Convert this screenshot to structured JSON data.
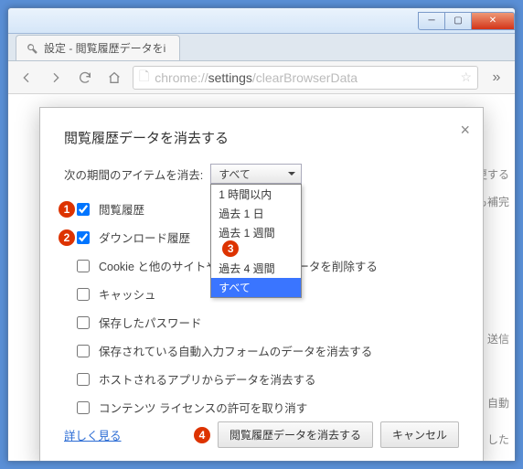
{
  "window": {
    "tab_title": "設定 - 閲覧履歴データをi"
  },
  "omnibox": {
    "prefix": "chrome://",
    "host": "settings",
    "path": "/clearBrowserData"
  },
  "background_hints": [
    "更する",
    "も補完",
    "送信",
    "自動",
    "した"
  ],
  "modal": {
    "title": "閲覧履歴データを消去する",
    "period_label": "次の期間のアイテムを消去:",
    "selected": "すべて",
    "options": [
      "1 時間以内",
      "過去 1 日",
      "過去 1 週間",
      "過去 4 週間",
      "すべて"
    ],
    "checkboxes": [
      {
        "label": "閲覧履歴",
        "checked": true,
        "badge": "1"
      },
      {
        "label": "ダウンロード履歴",
        "checked": true,
        "badge": "2"
      },
      {
        "label": "Cookie と他のサイトやプラグインのデータを削除する",
        "checked": false
      },
      {
        "label": "キャッシュ",
        "checked": false
      },
      {
        "label": "保存したパスワード",
        "checked": false
      },
      {
        "label": "保存されている自動入力フォームのデータを消去する",
        "checked": false
      },
      {
        "label": "ホストされるアプリからデータを消去する",
        "checked": false
      },
      {
        "label": "コンテンツ ライセンスの許可を取り消す",
        "checked": false
      }
    ],
    "dropdown_badge": "3",
    "learn_more": "詳しく見る",
    "primary_btn": "閲覧履歴データを消去する",
    "primary_badge": "4",
    "cancel_btn": "キャンセル"
  }
}
